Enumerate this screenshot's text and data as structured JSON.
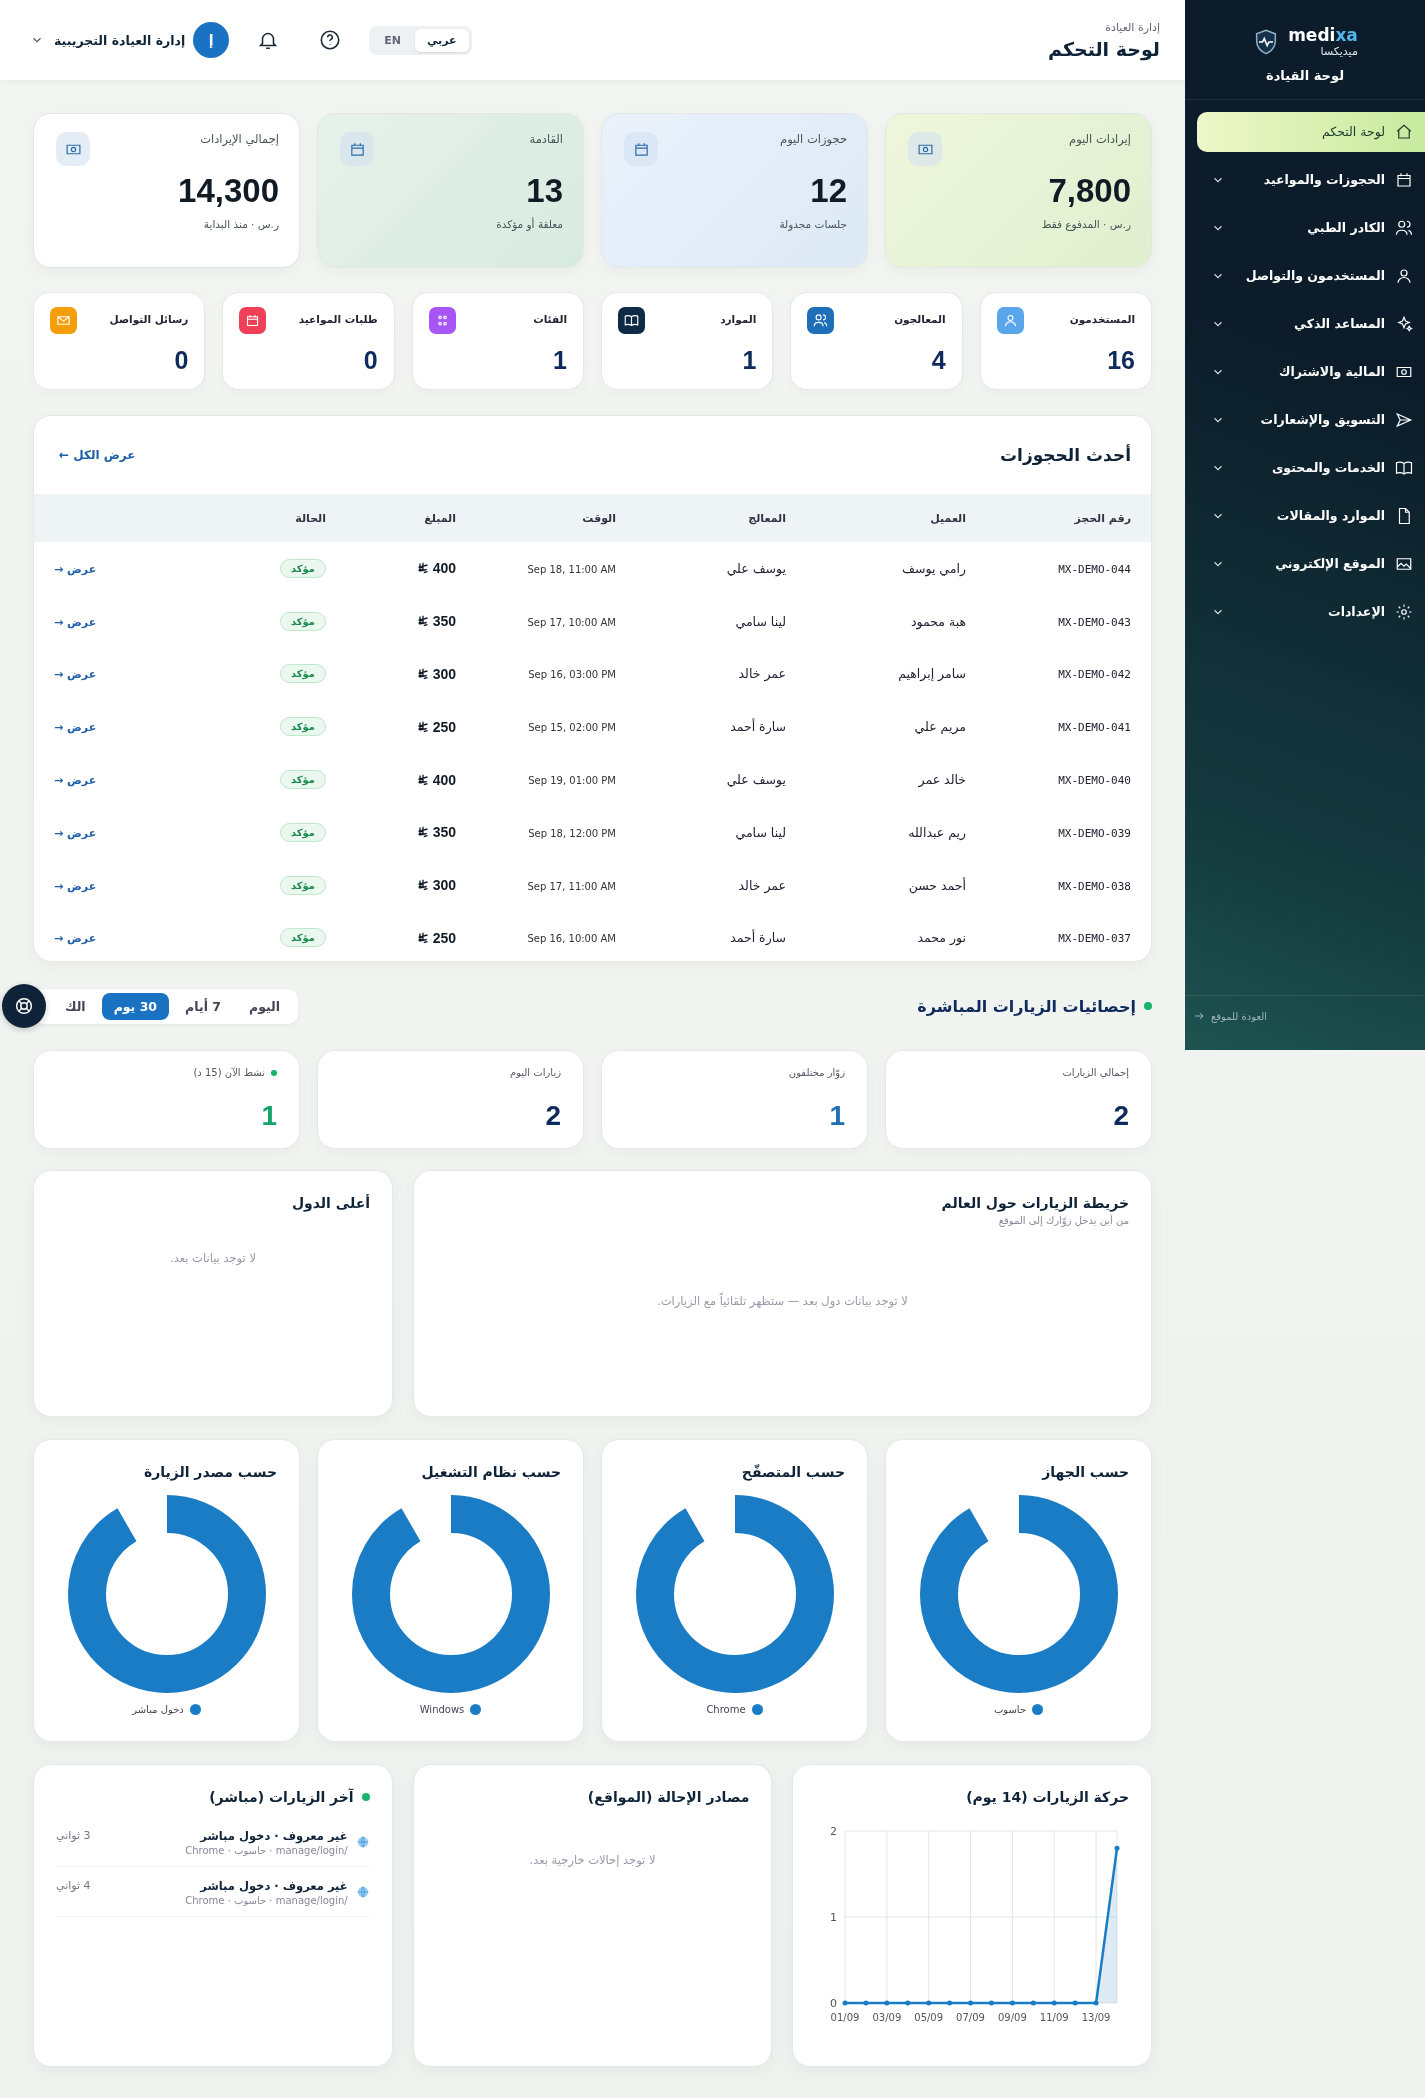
{
  "header": {
    "breadcrumb": "إدارة العيادة",
    "title": "لوحة التحكم",
    "languages": [
      {
        "label": "عربي",
        "selected": true
      },
      {
        "label": "EN",
        "selected": false
      }
    ],
    "user": {
      "avatar": "إ",
      "name": "إدارة العيادة التجريبية"
    }
  },
  "sidebar": {
    "logo": {
      "name_start": "medi",
      "name_end": "xa",
      "arabic": "ميديكسا"
    },
    "subtitle": "لوحة القيادة",
    "items": [
      {
        "label": "لوحة التحكم",
        "selected": true,
        "expandable": false
      },
      {
        "label": "الحجوزات والمواعيد",
        "selected": false,
        "expandable": true
      },
      {
        "label": "الكادر الطبي",
        "selected": false,
        "expandable": true
      },
      {
        "label": "المستخدمون والتواصل",
        "selected": false,
        "expandable": true
      },
      {
        "label": "المساعد الذكي",
        "selected": false,
        "expandable": true
      },
      {
        "label": "المالية والاشتراك",
        "selected": false,
        "expandable": true
      },
      {
        "label": "التسويق والإشعارات",
        "selected": false,
        "expandable": true
      },
      {
        "label": "الخدمات والمحتوى",
        "selected": false,
        "expandable": true
      },
      {
        "label": "الموارد والمقالات",
        "selected": false,
        "expandable": true
      },
      {
        "label": "الموقع الإلكتروني",
        "selected": false,
        "expandable": true
      },
      {
        "label": "الإعدادات",
        "selected": false,
        "expandable": true
      }
    ],
    "footer_link": "العودة للموقع"
  },
  "kpi_cards": [
    {
      "label": "إيرادات اليوم",
      "value": "7,800",
      "note": "ر.س · المدفوع فقط"
    },
    {
      "label": "حجوزات اليوم",
      "value": "12",
      "note": "جلسات مجدولة"
    },
    {
      "label": "القادمة",
      "value": "13",
      "note": "معلقة أو مؤكدة"
    },
    {
      "label": "إجمالي الإيرادات",
      "value": "14,300",
      "note": "ر.س · منذ البداية"
    }
  ],
  "count_cards": [
    {
      "label": "المستخدمون",
      "value": "16",
      "color": "#5aa6ea"
    },
    {
      "label": "المعالجون",
      "value": "4",
      "color": "#1f6fb8"
    },
    {
      "label": "الموارد",
      "value": "1",
      "color": "#0f2a44"
    },
    {
      "label": "الفئات",
      "value": "1",
      "color": "#a855f7"
    },
    {
      "label": "طلبات المواعيد",
      "value": "0",
      "color": "#ef4058"
    },
    {
      "label": "رسائل التواصل",
      "value": "0",
      "color": "#f59e0b"
    }
  ],
  "bookings": {
    "title": "أحدث الحجوزات",
    "view_all": "عرض الكل ←",
    "columns": [
      "رقم الحجز",
      "العميل",
      "المعالج",
      "الوقت",
      "المبلغ",
      "الحالة"
    ],
    "rows": [
      {
        "id": "MX-DEMO-044",
        "client": "رامي يوسف",
        "therapist": "يوسف علي",
        "time": "Sep 18, 11:00 AM",
        "amount": "400",
        "status": "مؤكد",
        "action": "عرض →"
      },
      {
        "id": "MX-DEMO-043",
        "client": "هبة محمود",
        "therapist": "لينا سامي",
        "time": "Sep 17, 10:00 AM",
        "amount": "350",
        "status": "مؤكد",
        "action": "عرض →"
      },
      {
        "id": "MX-DEMO-042",
        "client": "سامر إبراهيم",
        "therapist": "عمر خالد",
        "time": "Sep 16, 03:00 PM",
        "amount": "300",
        "status": "مؤكد",
        "action": "عرض →"
      },
      {
        "id": "MX-DEMO-041",
        "client": "مريم علي",
        "therapist": "سارة أحمد",
        "time": "Sep 15, 02:00 PM",
        "amount": "250",
        "status": "مؤكد",
        "action": "عرض →"
      },
      {
        "id": "MX-DEMO-040",
        "client": "خالد عمر",
        "therapist": "يوسف علي",
        "time": "Sep 19, 01:00 PM",
        "amount": "400",
        "status": "مؤكد",
        "action": "عرض →"
      },
      {
        "id": "MX-DEMO-039",
        "client": "ريم عبدالله",
        "therapist": "لينا سامي",
        "time": "Sep 18, 12:00 PM",
        "amount": "350",
        "status": "مؤكد",
        "action": "عرض →"
      },
      {
        "id": "MX-DEMO-038",
        "client": "أحمد حسن",
        "therapist": "عمر خالد",
        "time": "Sep 17, 11:00 AM",
        "amount": "300",
        "status": "مؤكد",
        "action": "عرض →"
      },
      {
        "id": "MX-DEMO-037",
        "client": "نور محمد",
        "therapist": "سارة أحمد",
        "time": "Sep 16, 10:00 AM",
        "amount": "250",
        "status": "مؤكد",
        "action": "عرض →"
      }
    ]
  },
  "live_stats": {
    "title": "إحصائيات الزيارات المباشرة",
    "live": true,
    "ranges": [
      {
        "label": "اليوم",
        "selected": false
      },
      {
        "label": "7 أيام",
        "selected": false
      },
      {
        "label": "30 يوم",
        "selected": true
      },
      {
        "label": "الك",
        "selected": false
      }
    ],
    "cards": [
      {
        "label": "إجمالي الزيارات",
        "value": "2",
        "color": "#0f2a5c",
        "live": false
      },
      {
        "label": "زوّار مختلفون",
        "value": "1",
        "color": "#1f6fb8",
        "live": false
      },
      {
        "label": "زيارات اليوم",
        "value": "2",
        "color": "#0f2a5c",
        "live": false
      },
      {
        "label": "نشط الآن (15 د)",
        "value": "1",
        "color": "#16a36a",
        "live": true
      }
    ]
  },
  "world_map": {
    "title": "خريطة الزيارات حول العالم",
    "subtitle": "من أين يدخل زوّارك إلى الموقع",
    "empty": "لا توجد بيانات دول بعد — ستظهر تلقائياً مع الزيارات."
  },
  "top_countries": {
    "title": "أعلى الدول",
    "empty": "لا توجد بيانات بعد."
  },
  "breakdowns": [
    {
      "title": "حسب الجهاز",
      "legend": "حاسوب",
      "color": "#1a7cc4"
    },
    {
      "title": "حسب المتصفّح",
      "legend": "Chrome",
      "color": "#1a7cc4"
    },
    {
      "title": "حسب نظام التشغيل",
      "legend": "Windows",
      "color": "#1a7cc4"
    },
    {
      "title": "حسب مصدر الزيارة",
      "legend": "دخول مباشر",
      "color": "#1a7cc4"
    }
  ],
  "traffic": {
    "title": "حركة الزيارات (14 يوم)",
    "chart_data": {
      "type": "area",
      "grid": true,
      "categories": [
        "01/09",
        null,
        "03/09",
        null,
        "05/09",
        null,
        "07/09",
        null,
        "09/09",
        null,
        "11/09",
        null,
        "13/09",
        null
      ],
      "ylim": [
        0,
        2
      ],
      "yticks": [
        {
          "value": 0,
          "label": "0"
        },
        {
          "value": 1,
          "label": "1"
        },
        {
          "value": 2,
          "label": "2"
        }
      ],
      "series": [
        {
          "color": "#1a7cc4",
          "values": [
            0,
            0,
            0,
            0,
            0,
            0,
            0,
            0,
            0,
            0,
            0,
            0,
            0,
            1.8
          ]
        }
      ]
    }
  },
  "referrers": {
    "title": "مصادر الإحالة (المواقع)",
    "empty": "لا توجد إحالات خارجية بعد."
  },
  "recent_visits": {
    "title": "آخر الزيارات (مباشر)",
    "live": true,
    "items": [
      {
        "title": "غير معروف · دخول مباشر",
        "detail": "/manage/login · حاسوب · Chrome",
        "time": "3 ثواني"
      },
      {
        "title": "غير معروف · دخول مباشر",
        "detail": "/manage/login · حاسوب · Chrome",
        "time": "4 ثواني"
      }
    ]
  }
}
